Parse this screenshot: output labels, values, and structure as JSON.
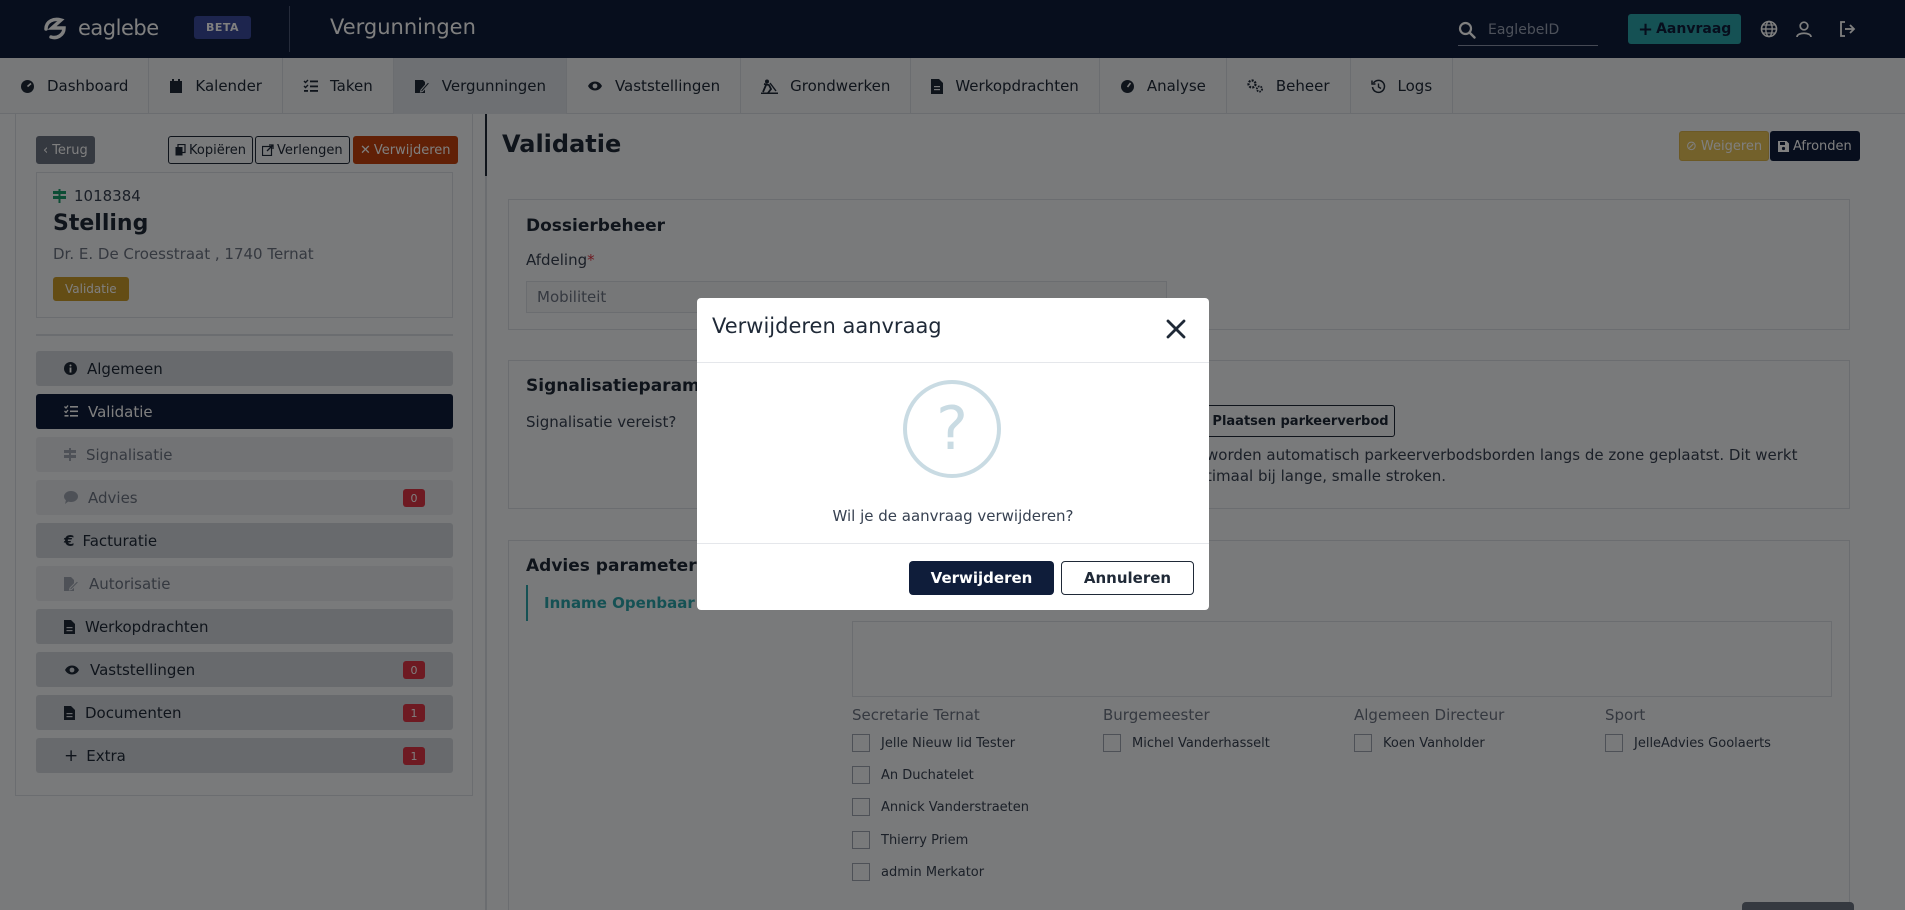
{
  "header": {
    "brand": "eaglebe",
    "beta": "BETA",
    "title": "Vergunningen",
    "search_placeholder": "EaglebeID",
    "new_request": "Aanvraag"
  },
  "nav": [
    {
      "label": "Dashboard",
      "icon": "dashboard-icon"
    },
    {
      "label": "Kalender",
      "icon": "calendar-icon"
    },
    {
      "label": "Taken",
      "icon": "tasks-icon"
    },
    {
      "label": "Vergunningen",
      "icon": "permit-icon",
      "active": true
    },
    {
      "label": "Vaststellingen",
      "icon": "eye-icon"
    },
    {
      "label": "Grondwerken",
      "icon": "digging-icon"
    },
    {
      "label": "Werkopdrachten",
      "icon": "file-icon"
    },
    {
      "label": "Analyse",
      "icon": "gauge-icon"
    },
    {
      "label": "Beheer",
      "icon": "cogs-icon"
    },
    {
      "label": "Logs",
      "icon": "history-icon"
    }
  ],
  "actions": {
    "back": "Terug",
    "copy": "Kopiëren",
    "extend": "Verlengen",
    "delete": "Verwijderen"
  },
  "dossier": {
    "number": "1018384",
    "type": "Stelling",
    "address": "Dr. E. De Croesstraat , 1740 Ternat",
    "status": "Validatie"
  },
  "sidebar": [
    {
      "label": "Algemeen",
      "state": "normal"
    },
    {
      "label": "Validatie",
      "state": "active"
    },
    {
      "label": "Signalisatie",
      "state": "dim"
    },
    {
      "label": "Advies",
      "state": "dim",
      "count": "0"
    },
    {
      "label": "Facturatie",
      "state": "normal"
    },
    {
      "label": "Autorisatie",
      "state": "dim"
    },
    {
      "label": "Werkopdrachten",
      "state": "normal"
    },
    {
      "label": "Vaststellingen",
      "state": "normal",
      "count": "0"
    },
    {
      "label": "Documenten",
      "state": "normal",
      "count": "1"
    },
    {
      "label": "Extra",
      "state": "normal",
      "count": "1"
    }
  ],
  "main": {
    "title": "Validatie",
    "reject": "Weigeren",
    "finish": "Afronden",
    "dossierbeheer": {
      "title": "Dossierbeheer",
      "afdeling_label": "Afdeling",
      "afdeling_value": "Mobiliteit"
    },
    "signalisatie": {
      "title": "Signalisatieparame",
      "vereist_label": "Signalisatie vereist?",
      "button": "Plaatsen parkeerverbod",
      "desc_line1": "worden automatisch parkeerverbodsborden langs de zone geplaatst. Dit werkt",
      "desc_line2": "timaal bij lange, smalle stroken."
    },
    "advies": {
      "title": "Advies parameters",
      "tab": "Inname Openbaar D",
      "groups": [
        {
          "title": "Secretarie Ternat",
          "members": [
            "Jelle Nieuw lid Tester",
            "An Duchatelet",
            "Annick Vanderstraeten",
            "Thierry Priem",
            "admin Merkator"
          ]
        },
        {
          "title": "Burgemeester",
          "members": [
            "Michel Vanderhasselt"
          ]
        },
        {
          "title": "Algemeen Directeur",
          "members": [
            "Koen Vanholder"
          ]
        },
        {
          "title": "Sport",
          "members": [
            "JelleAdvies Goolaerts"
          ]
        }
      ]
    }
  },
  "modal": {
    "title": "Verwijderen aanvraag",
    "question": "Wil je de aanvraag verwijderen?",
    "confirm": "Verwijderen",
    "cancel": "Annuleren"
  }
}
